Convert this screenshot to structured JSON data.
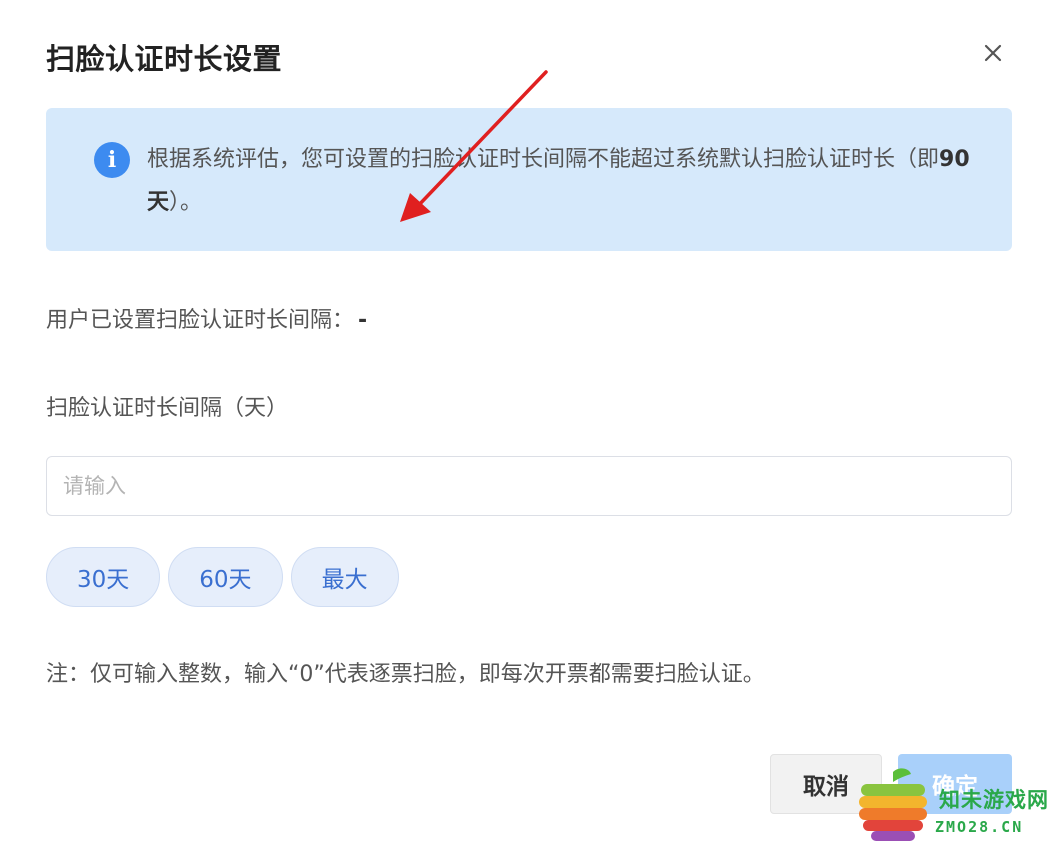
{
  "dialog": {
    "title": "扫脸认证时长设置",
    "close_icon": "close-icon"
  },
  "alert": {
    "icon": "info-icon",
    "text_before": "根据系统评估，您可设置的扫脸认证时长间隔不能超过系统默认扫脸认证时长（即",
    "text_bold": "90天",
    "text_after": "）。"
  },
  "current": {
    "label": "用户已设置扫脸认证时长间隔：",
    "value": "-"
  },
  "interval_field": {
    "label": "扫脸认证时长间隔（天）",
    "placeholder": "请输入",
    "value": ""
  },
  "presets": [
    {
      "label": "30天"
    },
    {
      "label": "60天"
    },
    {
      "label": "最大"
    }
  ],
  "note": "注：仅可输入整数，输入“0”代表逐票扫脸，即每次开票都需要扫脸认证。",
  "footer": {
    "cancel_label": "取消",
    "ok_label": "确定"
  },
  "watermark": {
    "text": "知未游戏网",
    "url_text": "ZMO28.CN"
  },
  "colors": {
    "accent": "#3d8bf0",
    "alert_bg": "#d6e9fb",
    "chip_bg": "#e6eefb",
    "ok_button": "#a9d0fa",
    "annotation_arrow": "#e02020"
  }
}
